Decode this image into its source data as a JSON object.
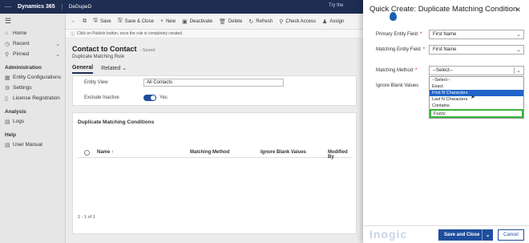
{
  "topbar": {
    "app_name": "Dynamics 365",
    "org_name": "DeDupeD",
    "right_text": "Try the"
  },
  "leftnav": {
    "items": [
      {
        "label": "Home",
        "icon": "home-icon"
      },
      {
        "label": "Recent",
        "icon": "clock-icon"
      },
      {
        "label": "Pinned",
        "icon": "pin-icon"
      }
    ],
    "section_admin": "Administration",
    "admin_items": [
      "Entity Configurations",
      "Settings",
      "License Registration"
    ],
    "section_analysis": "Analysis",
    "analysis_items": [
      "Logs"
    ],
    "section_help": "Help",
    "help_items": [
      "User Manual"
    ]
  },
  "cmdbar": {
    "save": "Save",
    "save_close": "Save & Close",
    "new": "New",
    "deactivate": "Deactivate",
    "delete": "Delete",
    "refresh": "Refresh",
    "check_access": "Check Access",
    "assign": "Assign"
  },
  "infobar": {
    "text": "Click on Publish button, once the rule is completely created."
  },
  "record": {
    "title": "Contact to Contact",
    "status": "- Saved",
    "subtitle": "Duplicate Matching Rule",
    "tab_general": "General",
    "tab_related": "Related",
    "entity_view_label": "Entity View",
    "entity_view_value": "All Contacts",
    "exclude_inactive_label": "Exclude Inactive",
    "exclude_inactive_value": "Yes",
    "grid_title": "Duplicate Matching Conditions",
    "col_name": "Name ↑",
    "col_method": "Matching Method",
    "col_blank": "Ignore Blank Values",
    "col_modified": "Modified By",
    "grid_footer": "1 - 1 of 1"
  },
  "quick_create": {
    "title": "Quick Create: Duplicate Matching Condition",
    "primary_label": "Primary Entity Field",
    "primary_value": "First Name",
    "matching_label": "Matching Entity Field",
    "matching_value": "First Name",
    "method_label": "Matching Method",
    "method_value": "--Select--",
    "ignore_label": "Ignore Blank Values",
    "options": [
      "--Select--",
      "Exact",
      "First N Characters",
      "Last N Characters",
      "Contains",
      "Fuzzy"
    ],
    "selected_option": "First N Characters",
    "highlighted_option": "Fuzzy",
    "save_close": "Save and Close",
    "cancel": "Cancel",
    "logo": "Inogic"
  },
  "colors": {
    "topbar": "#1e2d52",
    "primary": "#1f4e9d",
    "highlight": "#3bb33b",
    "selected": "#1f64c8"
  }
}
